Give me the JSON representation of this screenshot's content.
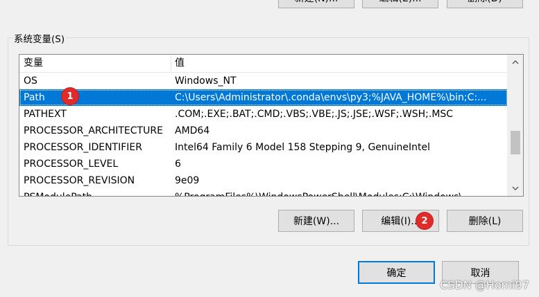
{
  "top_buttons": {
    "new": "新建(N)...",
    "edit": "编辑(E)...",
    "delete": "删除(D)"
  },
  "system_vars": {
    "group_label": "系统变量(S)",
    "columns": [
      "变量",
      "值"
    ],
    "rows": [
      {
        "name": "OS",
        "value": "Windows_NT"
      },
      {
        "name": "Path",
        "value": "C:\\Users\\Administrator\\.conda\\envs\\py3;%JAVA_HOME%\\bin;C:..."
      },
      {
        "name": "PATHEXT",
        "value": ".COM;.EXE;.BAT;.CMD;.VBS;.VBE;.JS;.JSE;.WSF;.WSH;.MSC"
      },
      {
        "name": "PROCESSOR_ARCHITECTURE",
        "value": "AMD64"
      },
      {
        "name": "PROCESSOR_IDENTIFIER",
        "value": "Intel64 Family 6 Model 158 Stepping 9, GenuineIntel"
      },
      {
        "name": "PROCESSOR_LEVEL",
        "value": "6"
      },
      {
        "name": "PROCESSOR_REVISION",
        "value": "9e09"
      },
      {
        "name": "PSModulePath",
        "value": "%ProgramFiles%\\WindowsPowerShell\\Modules;C:\\Windows\\..."
      }
    ],
    "selected_row": "Path",
    "new_button": "新建(W)...",
    "edit_button": "编辑(I)...",
    "delete_button": "删除(L)"
  },
  "dialog_buttons": {
    "ok": "确定",
    "cancel": "取消"
  },
  "annotations": {
    "badge1": "1",
    "badge2": "2"
  },
  "watermark": "CSDN @Homi97",
  "colors": {
    "selection": "#0078d7",
    "badge": "#e02b2b",
    "default_border": "#0078d7"
  },
  "icons": {
    "scroll_up": "chevron-up-icon",
    "scroll_down": "chevron-down-icon"
  }
}
